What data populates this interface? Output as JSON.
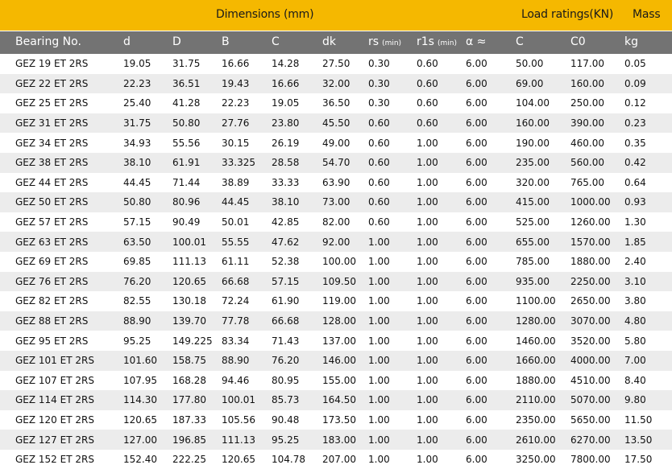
{
  "group_headers": {
    "dimensions": "Dimensions (mm)",
    "load_ratings": "Load ratings(KN)",
    "mass": "Mass"
  },
  "columns": [
    "Bearing No.",
    "d",
    "D",
    "B",
    "C",
    "dk",
    "rs",
    "r1s",
    "α ≈",
    "C",
    "C0",
    "kg"
  ],
  "min_note": "(min)",
  "colors": {
    "band": "#f5b800",
    "header": "#737373",
    "stripe": "#ececec"
  },
  "rows": [
    [
      "GEZ 19 ET 2RS",
      "19.05",
      "31.75",
      "16.66",
      "14.28",
      "27.50",
      "0.30",
      "0.60",
      "6.00",
      "50.00",
      "117.00",
      "0.05"
    ],
    [
      "GEZ 22 ET 2RS",
      "22.23",
      "36.51",
      "19.43",
      "16.66",
      "32.00",
      "0.30",
      "0.60",
      "6.00",
      "69.00",
      "160.00",
      "0.09"
    ],
    [
      "GEZ 25 ET 2RS",
      "25.40",
      "41.28",
      "22.23",
      "19.05",
      "36.50",
      "0.30",
      "0.60",
      "6.00",
      "104.00",
      "250.00",
      "0.12"
    ],
    [
      "GEZ 31 ET 2RS",
      "31.75",
      "50.80",
      "27.76",
      "23.80",
      "45.50",
      "0.60",
      "0.60",
      "6.00",
      "160.00",
      "390.00",
      "0.23"
    ],
    [
      "GEZ 34 ET 2RS",
      "34.93",
      "55.56",
      "30.15",
      "26.19",
      "49.00",
      "0.60",
      "1.00",
      "6.00",
      "190.00",
      "460.00",
      "0.35"
    ],
    [
      "GEZ 38 ET 2RS",
      "38.10",
      "61.91",
      "33.325",
      "28.58",
      "54.70",
      "0.60",
      "1.00",
      "6.00",
      "235.00",
      "560.00",
      "0.42"
    ],
    [
      "GEZ 44 ET 2RS",
      "44.45",
      "71.44",
      "38.89",
      "33.33",
      "63.90",
      "0.60",
      "1.00",
      "6.00",
      "320.00",
      "765.00",
      "0.64"
    ],
    [
      "GEZ 50 ET 2RS",
      "50.80",
      "80.96",
      "44.45",
      "38.10",
      "73.00",
      "0.60",
      "1.00",
      "6.00",
      "415.00",
      "1000.00",
      "0.93"
    ],
    [
      "GEZ 57 ET 2RS",
      "57.15",
      "90.49",
      "50.01",
      "42.85",
      "82.00",
      "0.60",
      "1.00",
      "6.00",
      "525.00",
      "1260.00",
      "1.30"
    ],
    [
      "GEZ 63 ET 2RS",
      "63.50",
      "100.01",
      "55.55",
      "47.62",
      "92.00",
      "1.00",
      "1.00",
      "6.00",
      "655.00",
      "1570.00",
      "1.85"
    ],
    [
      "GEZ 69 ET 2RS",
      "69.85",
      "111.13",
      "61.11",
      "52.38",
      "100.00",
      "1.00",
      "1.00",
      "6.00",
      "785.00",
      "1880.00",
      "2.40"
    ],
    [
      "GEZ 76 ET 2RS",
      "76.20",
      "120.65",
      "66.68",
      "57.15",
      "109.50",
      "1.00",
      "1.00",
      "6.00",
      "935.00",
      "2250.00",
      "3.10"
    ],
    [
      "GEZ 82 ET 2RS",
      "82.55",
      "130.18",
      "72.24",
      "61.90",
      "119.00",
      "1.00",
      "1.00",
      "6.00",
      "1100.00",
      "2650.00",
      "3.80"
    ],
    [
      "GEZ 88 ET 2RS",
      "88.90",
      "139.70",
      "77.78",
      "66.68",
      "128.00",
      "1.00",
      "1.00",
      "6.00",
      "1280.00",
      "3070.00",
      "4.80"
    ],
    [
      "GEZ 95 ET 2RS",
      "95.25",
      "149.225",
      "83.34",
      "71.43",
      "137.00",
      "1.00",
      "1.00",
      "6.00",
      "1460.00",
      "3520.00",
      "5.80"
    ],
    [
      "GEZ 101 ET 2RS",
      "101.60",
      "158.75",
      "88.90",
      "76.20",
      "146.00",
      "1.00",
      "1.00",
      "6.00",
      "1660.00",
      "4000.00",
      "7.00"
    ],
    [
      "GEZ 107 ET 2RS",
      "107.95",
      "168.28",
      "94.46",
      "80.95",
      "155.00",
      "1.00",
      "1.00",
      "6.00",
      "1880.00",
      "4510.00",
      "8.40"
    ],
    [
      "GEZ 114 ET 2RS",
      "114.30",
      "177.80",
      "100.01",
      "85.73",
      "164.50",
      "1.00",
      "1.00",
      "6.00",
      "2110.00",
      "5070.00",
      "9.80"
    ],
    [
      "GEZ 120 ET 2RS",
      "120.65",
      "187.33",
      "105.56",
      "90.48",
      "173.50",
      "1.00",
      "1.00",
      "6.00",
      "2350.00",
      "5650.00",
      "11.50"
    ],
    [
      "GEZ 127 ET 2RS",
      "127.00",
      "196.85",
      "111.13",
      "95.25",
      "183.00",
      "1.00",
      "1.00",
      "6.00",
      "2610.00",
      "6270.00",
      "13.50"
    ],
    [
      "GEZ 152 ET 2RS",
      "152.40",
      "222.25",
      "120.65",
      "104.78",
      "207.00",
      "1.00",
      "1.00",
      "6.00",
      "3250.00",
      "7800.00",
      "17.50"
    ]
  ]
}
